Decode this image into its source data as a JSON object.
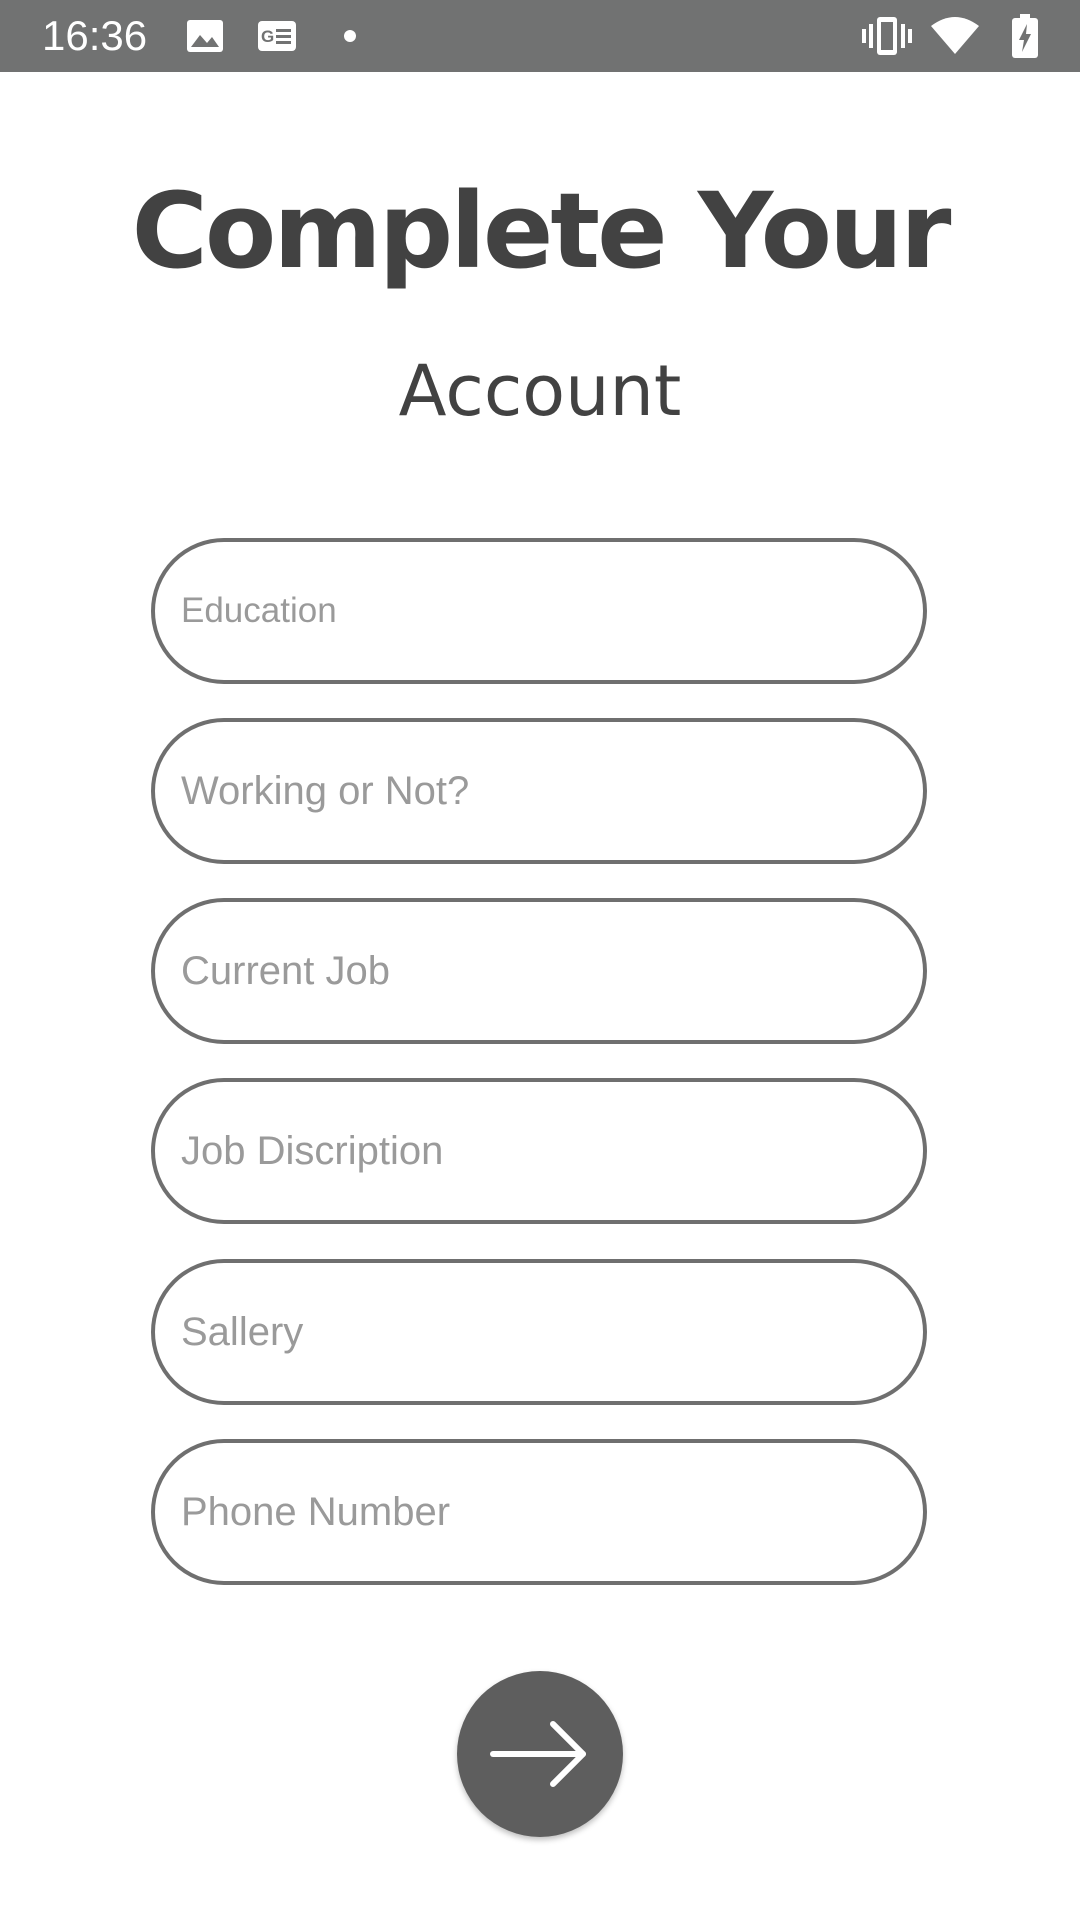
{
  "status_bar": {
    "time": "16:36",
    "left_icons": [
      "image-icon",
      "news-icon",
      "dot-icon"
    ],
    "right_icons": [
      "vibrate-icon",
      "wifi-icon",
      "battery-charging-icon"
    ]
  },
  "page": {
    "title": "Complete Your",
    "subtitle": "Account"
  },
  "form": {
    "fields": [
      {
        "name": "education",
        "value": "",
        "placeholder": "Education"
      },
      {
        "name": "working",
        "value": "",
        "placeholder": "Working or Not?"
      },
      {
        "name": "current_job",
        "value": "",
        "placeholder": "Current Job"
      },
      {
        "name": "job_description",
        "value": "",
        "placeholder": "Job Discription"
      },
      {
        "name": "sallery",
        "value": "",
        "placeholder": "Sallery"
      },
      {
        "name": "phone",
        "value": "",
        "placeholder": "Phone Number"
      }
    ]
  },
  "next_button": {
    "icon": "arrow-right-icon"
  }
}
